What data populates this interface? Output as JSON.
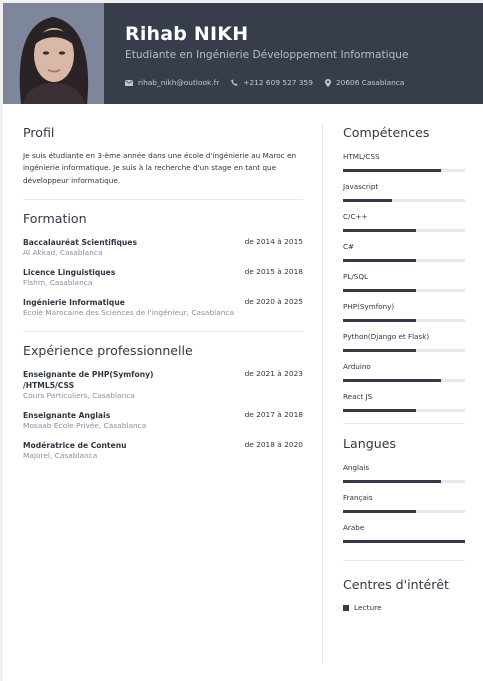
{
  "header": {
    "name": "Rihab NIKH",
    "subtitle": "Etudiante en Ingénierie Développement Informatique",
    "contacts": [
      {
        "icon": "envelope-icon",
        "text": "rihab_nikh@outlook.fr"
      },
      {
        "icon": "phone-icon",
        "text": "+212 609 527 359"
      },
      {
        "icon": "location-pin-icon",
        "text": "20606 Casablanca"
      }
    ]
  },
  "profile": {
    "title": "Profil",
    "text": "Je suis étudiante en 3-ème année dans une école d'ingénierie au Maroc en ingénierie informatique. Je suis à la recherche d'un stage en tant que développeur informatique."
  },
  "formation": {
    "title": "Formation",
    "items": [
      {
        "title": "Baccalauréat Scientifiques",
        "place": "Al Akkad, Casablanca",
        "date": "de 2014 à 2015"
      },
      {
        "title": "Licence Linguistiques",
        "place": "Flshm, Casablanca",
        "date": "de 2015 à 2018"
      },
      {
        "title": "Ingénierie Informatique",
        "place": "Ecole Marocaine des Sciences de l'ingénieur, Casablanca",
        "date": "de 2020 à 2025"
      }
    ]
  },
  "experience": {
    "title": "Expérience professionnelle",
    "items": [
      {
        "title_line1": "Enseignante de PHP(Symfony)",
        "title_line2": "/HTML5/CSS",
        "place": "Cours Particuliers, Casablanca",
        "date": "de 2021 à 2023"
      },
      {
        "title_line1": "Enseignante Anglais",
        "title_line2": "",
        "place": "Mosaab Ecole Privée, Casablanca",
        "date": "de 2017 à 2018"
      },
      {
        "title_line1": "Modératrice de Contenu",
        "title_line2": "",
        "place": "Majorel, Casablanca",
        "date": "de 2018 à 2020"
      }
    ]
  },
  "skills": {
    "title": "Compétences",
    "items": [
      {
        "name": "HTML/CSS",
        "level": 0.8
      },
      {
        "name": "Javascript",
        "level": 0.4
      },
      {
        "name": "C/C++",
        "level": 0.6
      },
      {
        "name": "C#",
        "level": 0.6
      },
      {
        "name": "PL/SQL",
        "level": 0.6
      },
      {
        "name": "PHP(Symfony)",
        "level": 0.6
      },
      {
        "name": "Python(Django et Flask)",
        "level": 0.6
      },
      {
        "name": "Arduino",
        "level": 0.8
      },
      {
        "name": "React JS",
        "level": 0.6
      }
    ]
  },
  "languages": {
    "title": "Langues",
    "items": [
      {
        "name": "Anglais",
        "level": 0.8
      },
      {
        "name": "Français",
        "level": 0.6
      },
      {
        "name": "Arabe",
        "level": 1.0
      }
    ]
  },
  "interests": {
    "title": "Centres d'intérêt",
    "items": [
      "Lecture"
    ]
  },
  "colors": {
    "header_bg": "#383d4c",
    "accent": "#353a48",
    "bar_track": "#e7e8eb"
  }
}
